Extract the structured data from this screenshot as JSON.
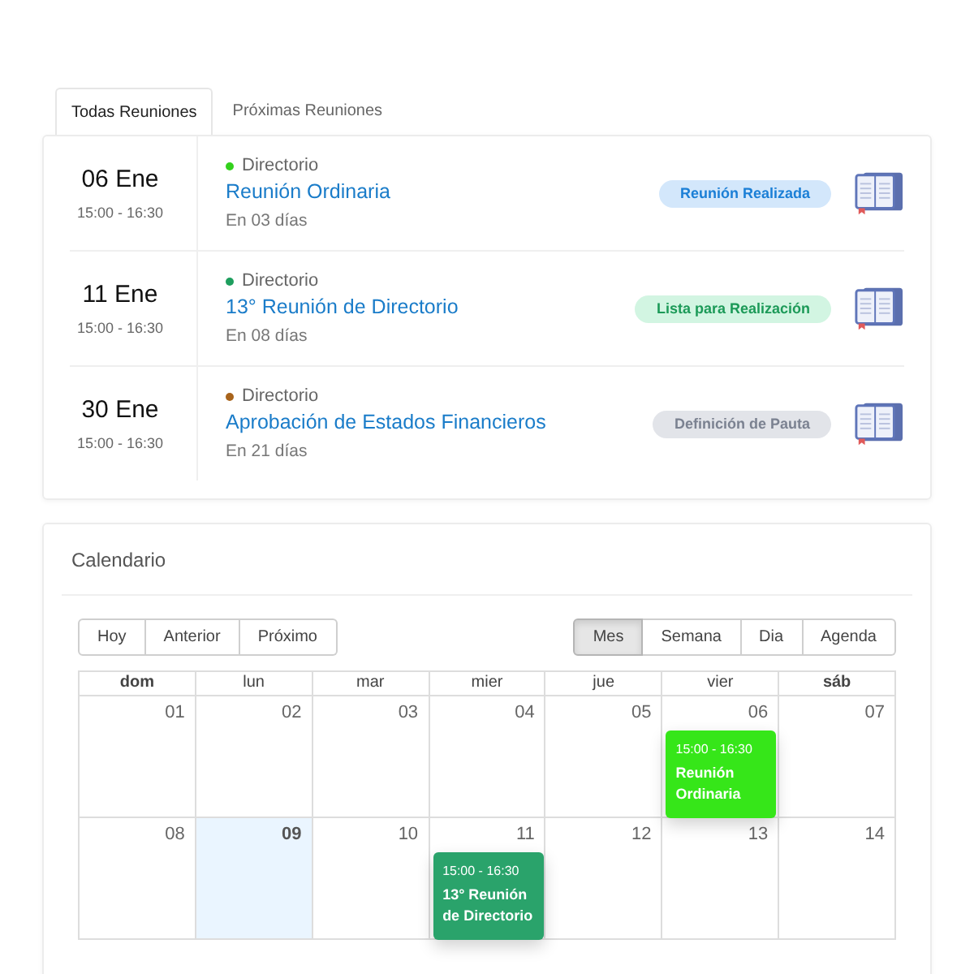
{
  "tabs": [
    {
      "label": "Todas Reuniones",
      "selected": true
    },
    {
      "label": "Próximas Reuniones",
      "selected": false
    }
  ],
  "meetings": [
    {
      "date": "06 Ene",
      "time": "15:00 - 16:30",
      "group": "Directorio",
      "color": "#33d11c",
      "title": "Reunión Ordinaria",
      "due": "En 03 días",
      "status": {
        "label": "Reunión Realizada",
        "kind": "done"
      }
    },
    {
      "date": "11 Ene",
      "time": "15:00 - 16:30",
      "group": "Directorio",
      "color": "#1e9e5e",
      "title": "13° Reunión de Directorio",
      "due": "En 08 días",
      "status": {
        "label": "Lista para Realización",
        "kind": "ready"
      }
    },
    {
      "date": "30 Ene",
      "time": "15:00 - 16:30",
      "group": "Directorio",
      "color": "#a8641c",
      "title": "Aprobación de Estados Financieros",
      "due": "En 21 días",
      "status": {
        "label": "Definición de Pauta",
        "kind": "pending"
      }
    }
  ],
  "calendar": {
    "title": "Calendario",
    "nav_buttons": [
      "Hoy",
      "Anterior",
      "Próximo"
    ],
    "views": [
      {
        "label": "Mes",
        "selected": true
      },
      {
        "label": "Semana",
        "selected": false
      },
      {
        "label": "Dia",
        "selected": false
      },
      {
        "label": "Agenda",
        "selected": false
      }
    ],
    "weekdays": [
      {
        "label": "dom",
        "weekend": true
      },
      {
        "label": "lun",
        "weekend": false
      },
      {
        "label": "mar",
        "weekend": false
      },
      {
        "label": "mier",
        "weekend": false
      },
      {
        "label": "jue",
        "weekend": false
      },
      {
        "label": "vier",
        "weekend": false
      },
      {
        "label": "sáb",
        "weekend": true
      }
    ],
    "weeks": [
      {
        "days": [
          {
            "day": "01",
            "today": false
          },
          {
            "day": "02",
            "today": false
          },
          {
            "day": "03",
            "today": false
          },
          {
            "day": "04",
            "today": false
          },
          {
            "day": "05",
            "today": false
          },
          {
            "day": "06",
            "today": false,
            "events": [
              {
                "time": "15:00 - 16:30",
                "title": "Reunión Ordinaria",
                "color": "#36e619"
              }
            ]
          },
          {
            "day": "07",
            "today": false
          }
        ]
      },
      {
        "days": [
          {
            "day": "08",
            "today": false
          },
          {
            "day": "09",
            "today": true
          },
          {
            "day": "10",
            "today": false
          },
          {
            "day": "11",
            "today": false,
            "events": [
              {
                "time": "15:00 - 16:30",
                "title": "13° Reunión de Directorio",
                "color": "#2aa36b"
              }
            ]
          },
          {
            "day": "12",
            "today": false
          },
          {
            "day": "13",
            "today": false
          },
          {
            "day": "14",
            "today": false
          }
        ]
      }
    ]
  }
}
